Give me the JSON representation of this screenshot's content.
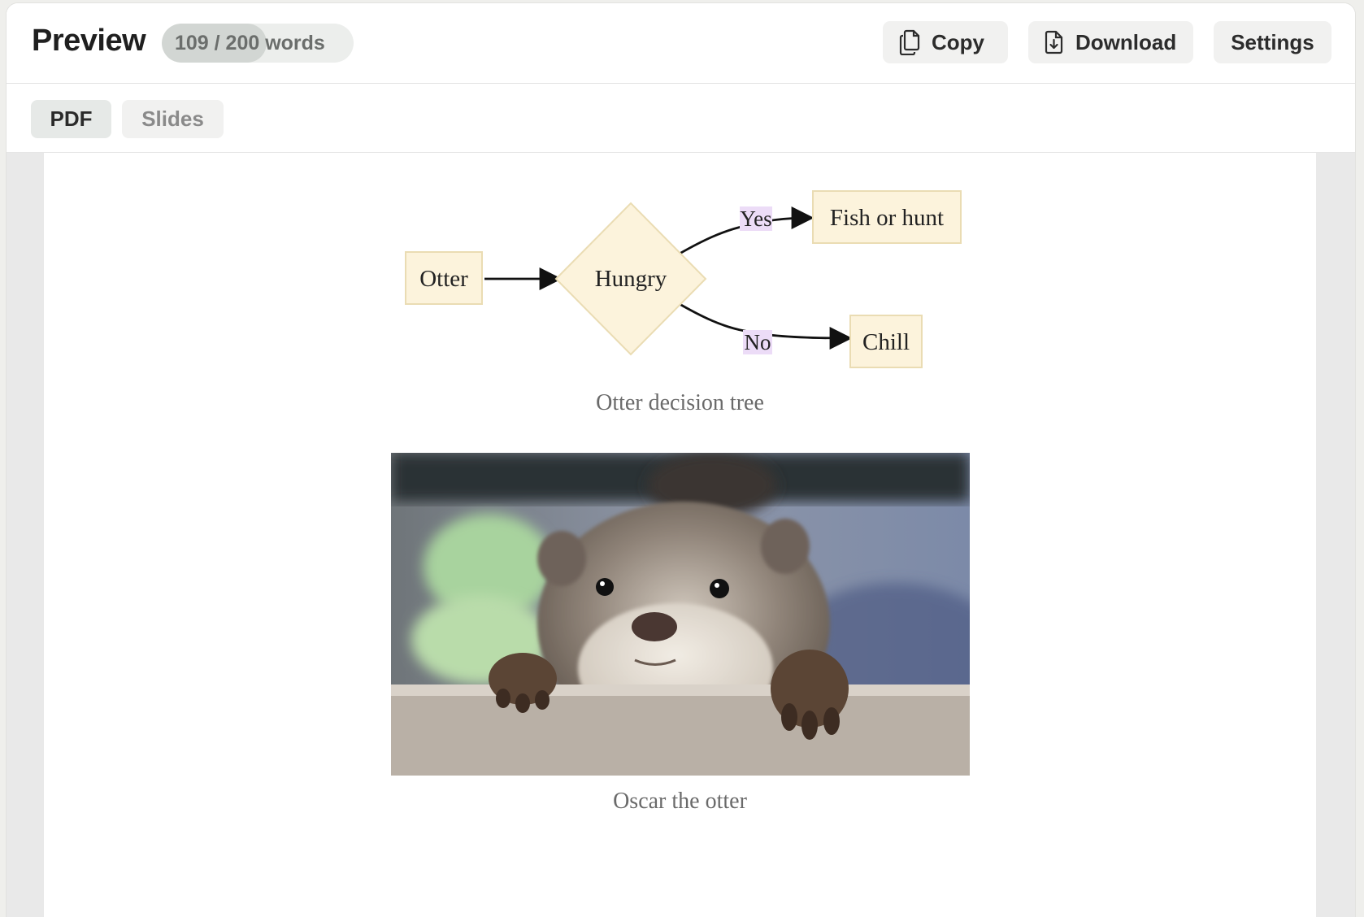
{
  "header": {
    "title": "Preview",
    "word_count": {
      "label": "109 / 200 words",
      "used": 109,
      "limit": 200
    },
    "buttons": {
      "copy": "Copy",
      "download": "Download",
      "settings": "Settings"
    }
  },
  "tabs": [
    {
      "label": "PDF",
      "active": true
    },
    {
      "label": "Slides",
      "active": false
    }
  ],
  "document": {
    "diagram": {
      "nodes": {
        "start": "Otter",
        "decision": "Hungry",
        "yes_target": "Fish or hunt",
        "no_target": "Chill"
      },
      "edges": {
        "yes": "Yes",
        "no": "No"
      },
      "caption": "Otter decision tree"
    },
    "figure": {
      "caption": "Oscar the otter"
    }
  },
  "colors": {
    "node_fill": "#fcf3dc",
    "node_stroke": "#eadcb3",
    "edge_label_bg": "#ecdcf7",
    "page_bg": "#ffffff",
    "viewer_bg": "#e9e9e9"
  },
  "icons": {
    "copy": "copy-icon",
    "download": "file-download-icon"
  }
}
